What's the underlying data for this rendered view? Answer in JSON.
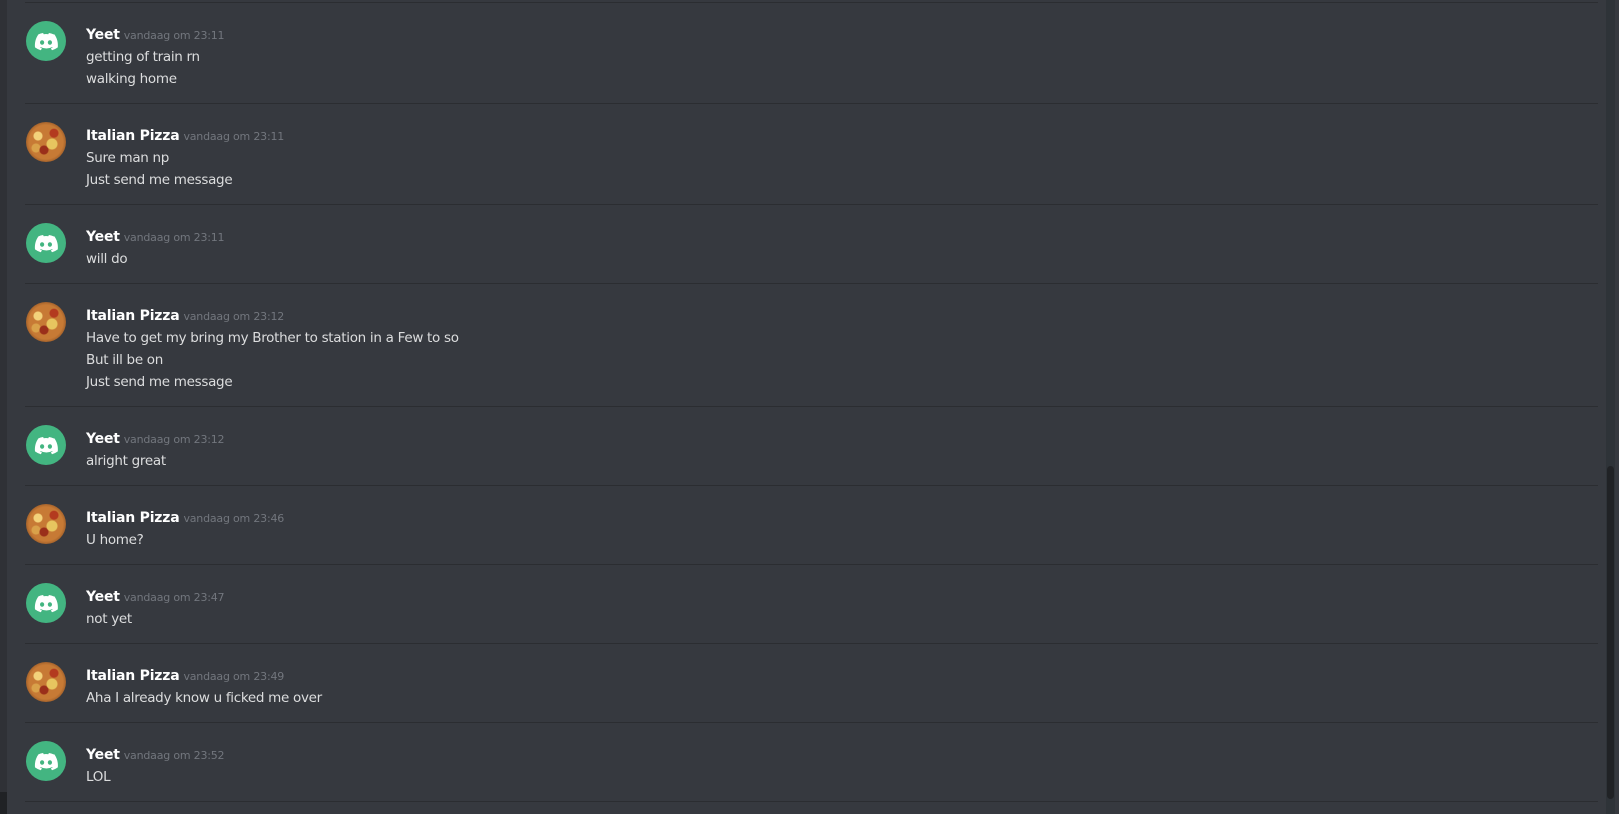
{
  "colors": {
    "background": "#36393f",
    "discord_avatar": "#43b581",
    "username": "#ffffff",
    "timestamp": "#72767d",
    "message_text": "#dcddde"
  },
  "messages": [
    {
      "author": "Yeet",
      "avatar_icon": "discord-logo-icon",
      "timestamp": "vandaag om 23:11",
      "lines": [
        "getting of train rn",
        "walking home"
      ]
    },
    {
      "author": "Italian Pizza",
      "avatar_icon": "pizza-avatar",
      "timestamp": "vandaag om 23:11",
      "lines": [
        "Sure man np",
        "Just send me message"
      ]
    },
    {
      "author": "Yeet",
      "avatar_icon": "discord-logo-icon",
      "timestamp": "vandaag om 23:11",
      "lines": [
        "will do"
      ]
    },
    {
      "author": "Italian Pizza",
      "avatar_icon": "pizza-avatar",
      "timestamp": "vandaag om 23:12",
      "lines": [
        "Have to get my bring my Brother to station in a Few to so",
        "But ill be on",
        "Just send me message"
      ]
    },
    {
      "author": "Yeet",
      "avatar_icon": "discord-logo-icon",
      "timestamp": "vandaag om 23:12",
      "lines": [
        "alright great"
      ]
    },
    {
      "author": "Italian Pizza",
      "avatar_icon": "pizza-avatar",
      "timestamp": "vandaag om 23:46",
      "lines": [
        "U home?"
      ]
    },
    {
      "author": "Yeet",
      "avatar_icon": "discord-logo-icon",
      "timestamp": "vandaag om 23:47",
      "lines": [
        "not yet"
      ]
    },
    {
      "author": "Italian Pizza",
      "avatar_icon": "pizza-avatar",
      "timestamp": "vandaag om 23:49",
      "lines": [
        "Aha I already know u ficked me over"
      ]
    },
    {
      "author": "Yeet",
      "avatar_icon": "discord-logo-icon",
      "timestamp": "vandaag om 23:52",
      "lines": [
        "LOL"
      ]
    }
  ]
}
